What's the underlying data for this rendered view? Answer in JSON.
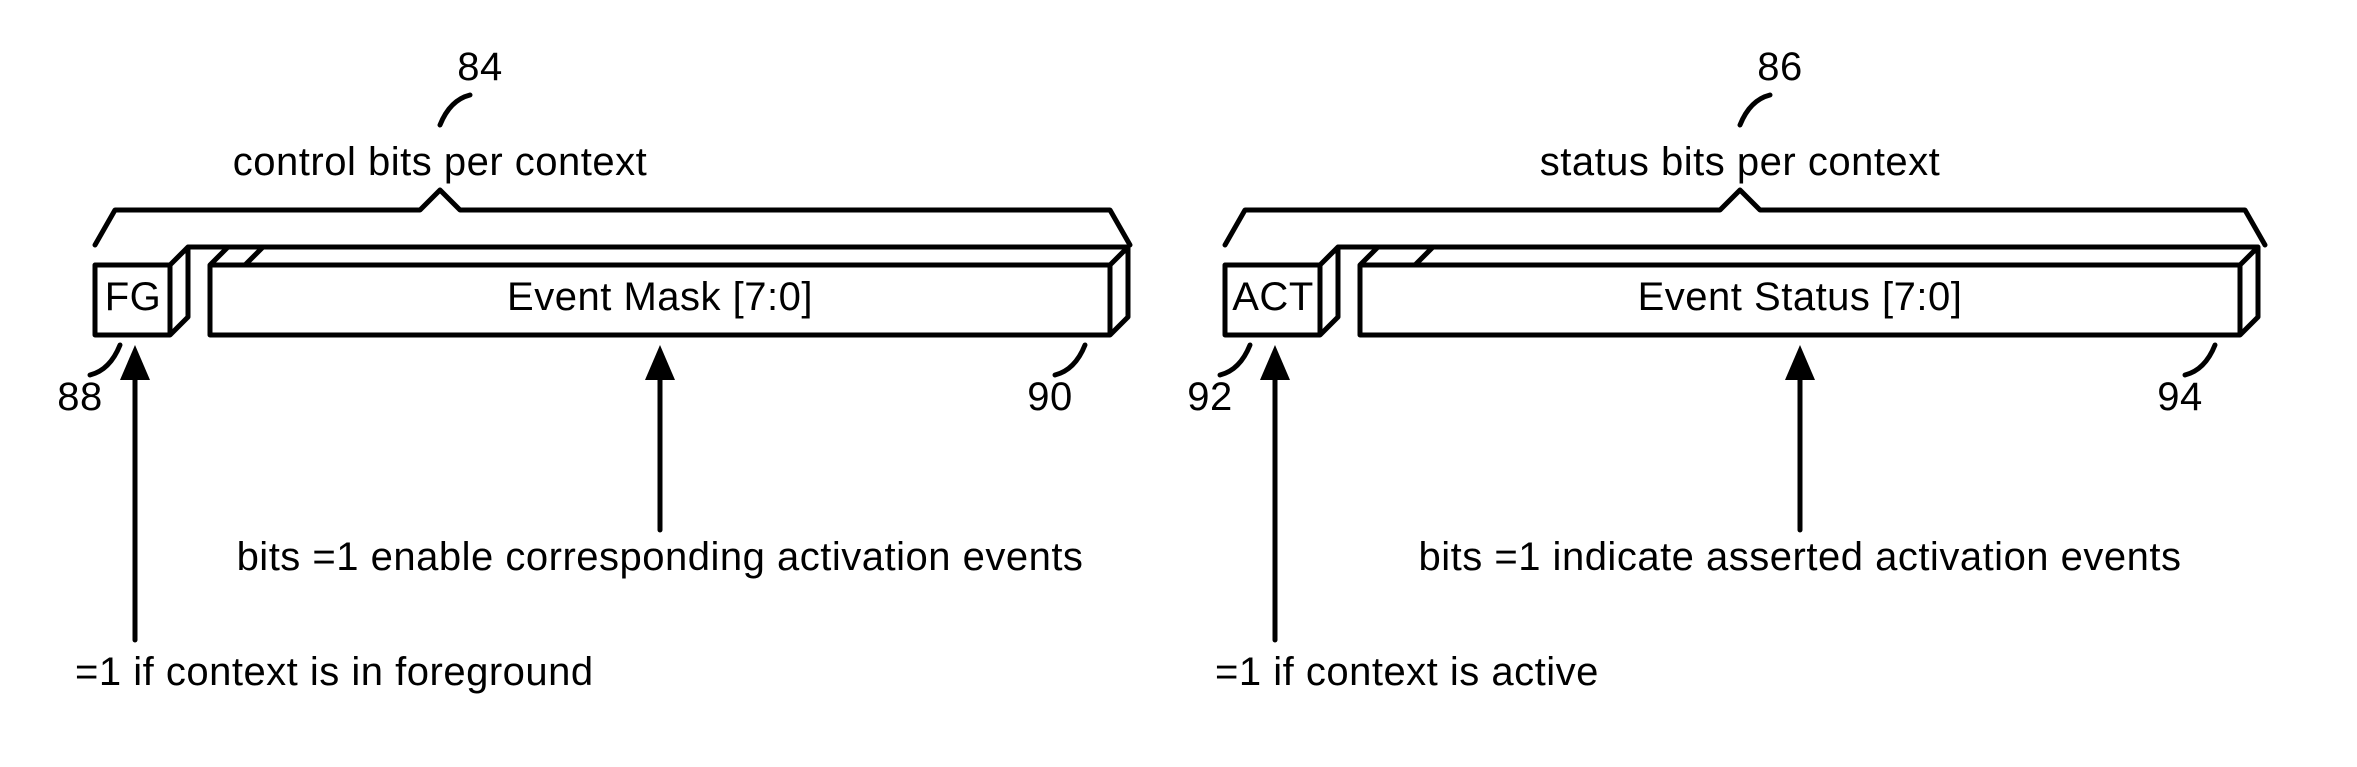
{
  "refs": {
    "r84": "84",
    "r86": "86",
    "r88": "88",
    "r90": "90",
    "r92": "92",
    "r94": "94"
  },
  "left": {
    "brace_label": "control bits per context",
    "small_field": "FG",
    "big_field": "Event Mask [7:0]",
    "big_note": "bits =1 enable corresponding activation events",
    "small_note": "=1 if context is in foreground"
  },
  "right": {
    "brace_label": "status bits per context",
    "small_field": "ACT",
    "big_field": "Event Status [7:0]",
    "big_note": "bits =1 indicate asserted activation events",
    "small_note": "=1 if context is active"
  }
}
